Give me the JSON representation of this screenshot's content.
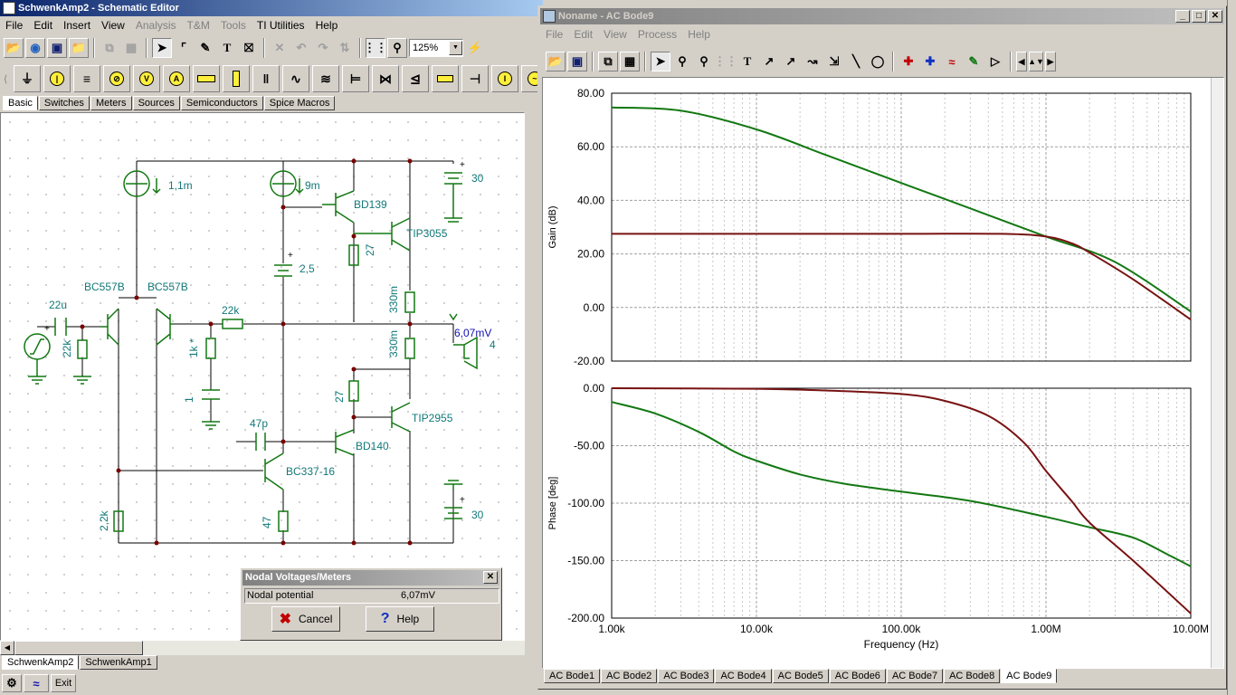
{
  "schematic": {
    "title": "SchwenkAmp2 - Schematic Editor",
    "menu": [
      "File",
      "Edit",
      "Insert",
      "View",
      "Analysis",
      "T&M",
      "Tools",
      "TI Utilities",
      "Help"
    ],
    "menu_disabled": [
      false,
      false,
      false,
      false,
      true,
      true,
      true,
      false,
      false
    ],
    "zoom": "125%",
    "component_tabs": [
      "Basic",
      "Switches",
      "Meters",
      "Sources",
      "Semiconductors",
      "Spice Macros"
    ],
    "bottom_tabs": [
      "SchwenkAmp2",
      "SchwenkAmp1"
    ],
    "exit_label": "Exit",
    "labels": {
      "cs1": "1,1m",
      "cs2": "9m",
      "bat1": "30",
      "bat2": "2,5",
      "bat3": "30",
      "q_bd139": "BD139",
      "q_tip3055": "TIP3055",
      "q_bc557b_1": "BC557B",
      "q_bc557b_2": "BC557B",
      "q_bd140": "BD140",
      "q_tip2955": "TIP2955",
      "q_bc337": "BC337-16",
      "c_in": "22u",
      "r_in": "22k",
      "r_fb": "22k",
      "r_1k": "1k *",
      "c_1": "1",
      "r_27a": "27",
      "r_330a": "330m",
      "r_330b": "330m",
      "r_27b": "27",
      "c_47p": "47p",
      "r_47": "47",
      "r_2k2": "2,2k",
      "meter": "6,07mV",
      "load": "4",
      "plus": "+"
    }
  },
  "nodal": {
    "title": "Nodal Voltages/Meters",
    "label": "Nodal potential",
    "value": "6,07mV",
    "cancel": "Cancel",
    "help": "Help"
  },
  "bode": {
    "title": "Noname - AC Bode9",
    "menu": [
      "File",
      "Edit",
      "View",
      "Process",
      "Help"
    ],
    "tabs": [
      "AC Bode1",
      "AC Bode2",
      "AC Bode3",
      "AC Bode4",
      "AC Bode5",
      "AC Bode6",
      "AC Bode7",
      "AC Bode8",
      "AC Bode9"
    ],
    "active_tab": 8
  },
  "chart_data": [
    {
      "type": "line",
      "ylabel": "Gain (dB)",
      "xscale": "log",
      "xlim": [
        1000,
        10000000
      ],
      "ylim": [
        -20,
        80
      ],
      "yticks": [
        "80.00",
        "60.00",
        "40.00",
        "20.00",
        "0.00",
        "-20.00"
      ],
      "grid": true,
      "series": [
        {
          "color": "#127812",
          "x": [
            1000,
            3000,
            10000,
            30000,
            100000,
            300000,
            1000000,
            3000000,
            10000000
          ],
          "y": [
            74.7,
            73.5,
            66.5,
            57.0,
            46.5,
            37.0,
            26.5,
            17.0,
            -1.5
          ]
        },
        {
          "color": "#781212",
          "x": [
            1000,
            10000,
            100000,
            500000,
            1000000,
            1500000,
            2000000,
            4000000,
            10000000
          ],
          "y": [
            27.5,
            27.5,
            27.5,
            27.5,
            26.5,
            24.0,
            20.5,
            10.5,
            -4.5
          ]
        }
      ]
    },
    {
      "type": "line",
      "xlabel": "Frequency (Hz)",
      "ylabel": "Phase [deg]",
      "xscale": "log",
      "xlim": [
        1000,
        10000000
      ],
      "ylim": [
        -200,
        0
      ],
      "xticks": [
        "1.00k",
        "10.00k",
        "100.00k",
        "1.00M",
        "10.00M"
      ],
      "yticks": [
        "0.00",
        "-50.00",
        "-100.00",
        "-150.00",
        "-200.00"
      ],
      "grid": true,
      "series": [
        {
          "color": "#127812",
          "x": [
            1000,
            2000,
            4000,
            7000,
            10000,
            20000,
            40000,
            100000,
            300000,
            1000000,
            2000000,
            4000000,
            7000000,
            10000000
          ],
          "y": [
            -12,
            -22,
            -38,
            -55,
            -63,
            -75,
            -83,
            -90,
            -98,
            -112,
            -121,
            -130,
            -145,
            -155
          ]
        },
        {
          "color": "#781212",
          "x": [
            1000,
            10000,
            30000,
            100000,
            200000,
            400000,
            700000,
            1000000,
            1500000,
            2000000,
            4000000,
            10000000
          ],
          "y": [
            0,
            -0.5,
            -2,
            -5,
            -11,
            -24,
            -47,
            -72,
            -98,
            -117,
            -150,
            -196
          ]
        }
      ]
    }
  ]
}
